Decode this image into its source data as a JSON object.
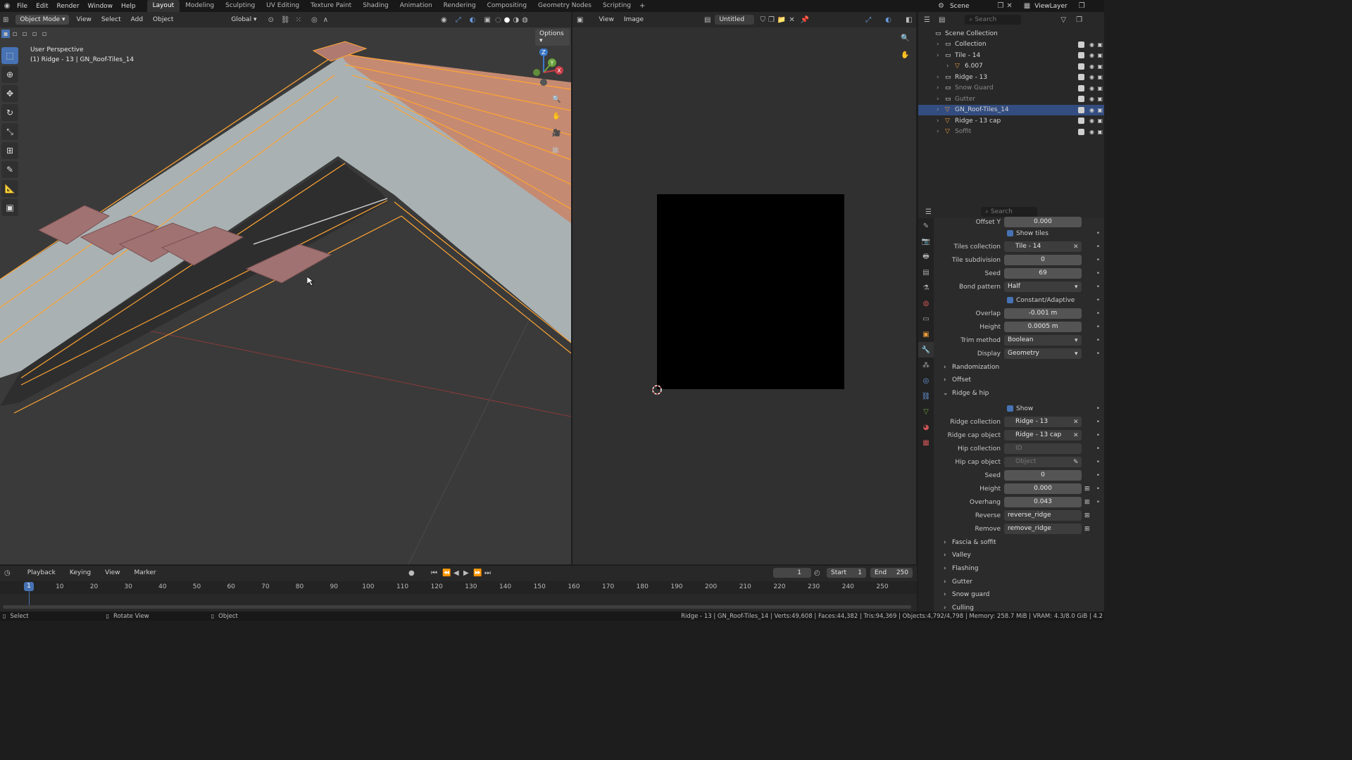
{
  "topbar": {
    "menus": [
      "File",
      "Edit",
      "Render",
      "Window",
      "Help"
    ],
    "workspaces": [
      "Layout",
      "Modeling",
      "Sculpting",
      "UV Editing",
      "Texture Paint",
      "Shading",
      "Animation",
      "Rendering",
      "Compositing",
      "Geometry Nodes",
      "Scripting"
    ],
    "active_workspace": "Layout",
    "scene": "Scene",
    "view_layer": "ViewLayer"
  },
  "viewport": {
    "mode": "Object Mode",
    "menus": [
      "View",
      "Select",
      "Add",
      "Object"
    ],
    "transform": "Global",
    "options": "Options",
    "info_line1": "User Perspective",
    "info_line2": "(1) Ridge - 13 | GN_Roof-Tiles_14",
    "gizmo": {
      "z": "Z",
      "y": "Y",
      "x": "X"
    }
  },
  "image_editor": {
    "menus": [
      "View",
      "Image"
    ],
    "image_name": "Untitled"
  },
  "outliner": {
    "search_placeholder": "Search",
    "rows": [
      {
        "label": "Scene Collection",
        "indent": 0,
        "icon": "collection-icon",
        "state": "normal"
      },
      {
        "label": "Collection",
        "indent": 1,
        "icon": "collection-icon",
        "state": "normal"
      },
      {
        "label": "Tile - 14",
        "indent": 1,
        "icon": "collection-icon",
        "state": "normal"
      },
      {
        "label": "6.007",
        "indent": 2,
        "icon": "mesh-icon",
        "state": "normal"
      },
      {
        "label": "Ridge - 13",
        "indent": 1,
        "icon": "collection-icon",
        "state": "normal"
      },
      {
        "label": "Snow Guard",
        "indent": 1,
        "icon": "collection-icon",
        "state": "dim"
      },
      {
        "label": "Gutter",
        "indent": 1,
        "icon": "collection-icon",
        "state": "dim"
      },
      {
        "label": "GN_Roof-Tiles_14",
        "indent": 1,
        "icon": "mesh-icon",
        "state": "selected"
      },
      {
        "label": "Ridge - 13 cap",
        "indent": 1,
        "icon": "mesh-icon",
        "state": "normal"
      },
      {
        "label": "Soffit",
        "indent": 1,
        "icon": "mesh-icon",
        "state": "dim"
      }
    ]
  },
  "properties": {
    "search_placeholder": "Search",
    "offset_label": "Offset Y",
    "offset_value": "0.000",
    "show_tiles": "Show tiles",
    "tiles_collection": {
      "label": "Tiles collection",
      "value": "Tile - 14"
    },
    "tile_subdivision": {
      "label": "Tile subdivision",
      "value": "0"
    },
    "seed": {
      "label": "Seed",
      "value": "69"
    },
    "bond_pattern": {
      "label": "Bond pattern",
      "value": "Half"
    },
    "constant_adaptive": "Constant/Adaptive",
    "overlap": {
      "label": "Overlap",
      "value": "-0.001 m"
    },
    "height": {
      "label": "Height",
      "value": "0.0005 m"
    },
    "trim_method": {
      "label": "Trim method",
      "value": "Boolean"
    },
    "display": {
      "label": "Display",
      "value": "Geometry"
    },
    "panel_randomization": "Randomization",
    "panel_offset": "Offset",
    "panel_ridge": "Ridge & hip",
    "ridge_show": "Show",
    "ridge_collection": {
      "label": "Ridge collection",
      "value": "Ridge - 13"
    },
    "ridge_cap_object": {
      "label": "Ridge cap object",
      "value": "Ridge - 13 cap"
    },
    "hip_collection": {
      "label": "Hip collection",
      "placeholder": "ID"
    },
    "hip_cap_object": {
      "label": "Hip cap object",
      "placeholder": "Object"
    },
    "ridge_seed": {
      "label": "Seed",
      "value": "0"
    },
    "ridge_height": {
      "label": "Height",
      "value": "0.000"
    },
    "overhang": {
      "label": "Overhang",
      "value": "0.043"
    },
    "reverse": {
      "label": "Reverse",
      "value": "reverse_ridge"
    },
    "remove": {
      "label": "Remove",
      "value": "remove_ridge"
    },
    "panels_closed": [
      "Fascia & soffit",
      "Valley",
      "Flashing",
      "Gutter",
      "Snow guard",
      "Culling"
    ]
  },
  "timeline": {
    "menus": [
      "Playback",
      "Keying",
      "View",
      "Marker"
    ],
    "current_frame": "1",
    "start_label": "Start",
    "start_value": "1",
    "end_label": "End",
    "end_value": "250",
    "ticks": [
      1,
      10,
      20,
      30,
      40,
      50,
      60,
      70,
      80,
      90,
      100,
      110,
      120,
      130,
      140,
      150,
      160,
      170,
      180,
      190,
      200,
      210,
      220,
      230,
      240,
      250
    ]
  },
  "statusbar": {
    "select": "Select",
    "rotate": "Rotate View",
    "object": "Object",
    "stats": "Ridge - 13 | GN_Roof-Tiles_14 | Verts:49,608 | Faces:44,382 | Tris:94,369 | Objects:4,792/4,798 | Memory: 258.7 MiB | VRAM: 4.3/8.0 GiB | 4.2"
  },
  "colors": {
    "accent": "#4772b3",
    "selection_orange": "#ffa533",
    "tile_color": "#9c7070"
  }
}
